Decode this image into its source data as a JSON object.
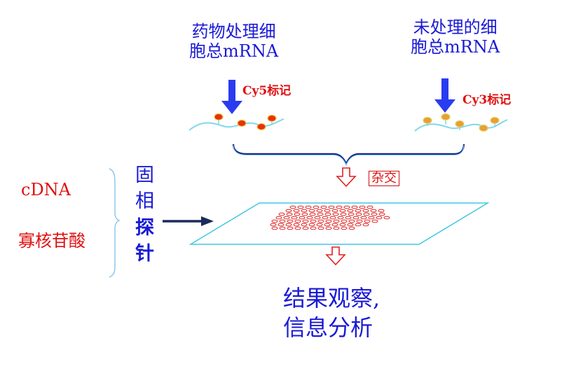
{
  "left_sample": {
    "line1": "药物处理细",
    "line2": "胞总mRNA",
    "dye": "Cy5标记"
  },
  "right_sample": {
    "line1": "未处理的细",
    "line2": "胞总mRNA",
    "dye": "Cy3标记"
  },
  "hybridization_label": "杂交",
  "probe_types": {
    "cdna": "cDNA",
    "oligo": "寡核苷酸"
  },
  "probe_label": {
    "c1": "固",
    "c2": "相",
    "c3": "探",
    "c4": "针"
  },
  "result_text": {
    "line1": "结果观察,",
    "line2": "信息分析"
  },
  "colors": {
    "label_blue": "#1a1ad6",
    "red_text": "#e01010",
    "cy5_dot": "#e83010",
    "cy3_dot": "#e8a030",
    "curve": "#7fd8e8",
    "chip_outline": "#40c8e0",
    "spot": "#e02020"
  }
}
